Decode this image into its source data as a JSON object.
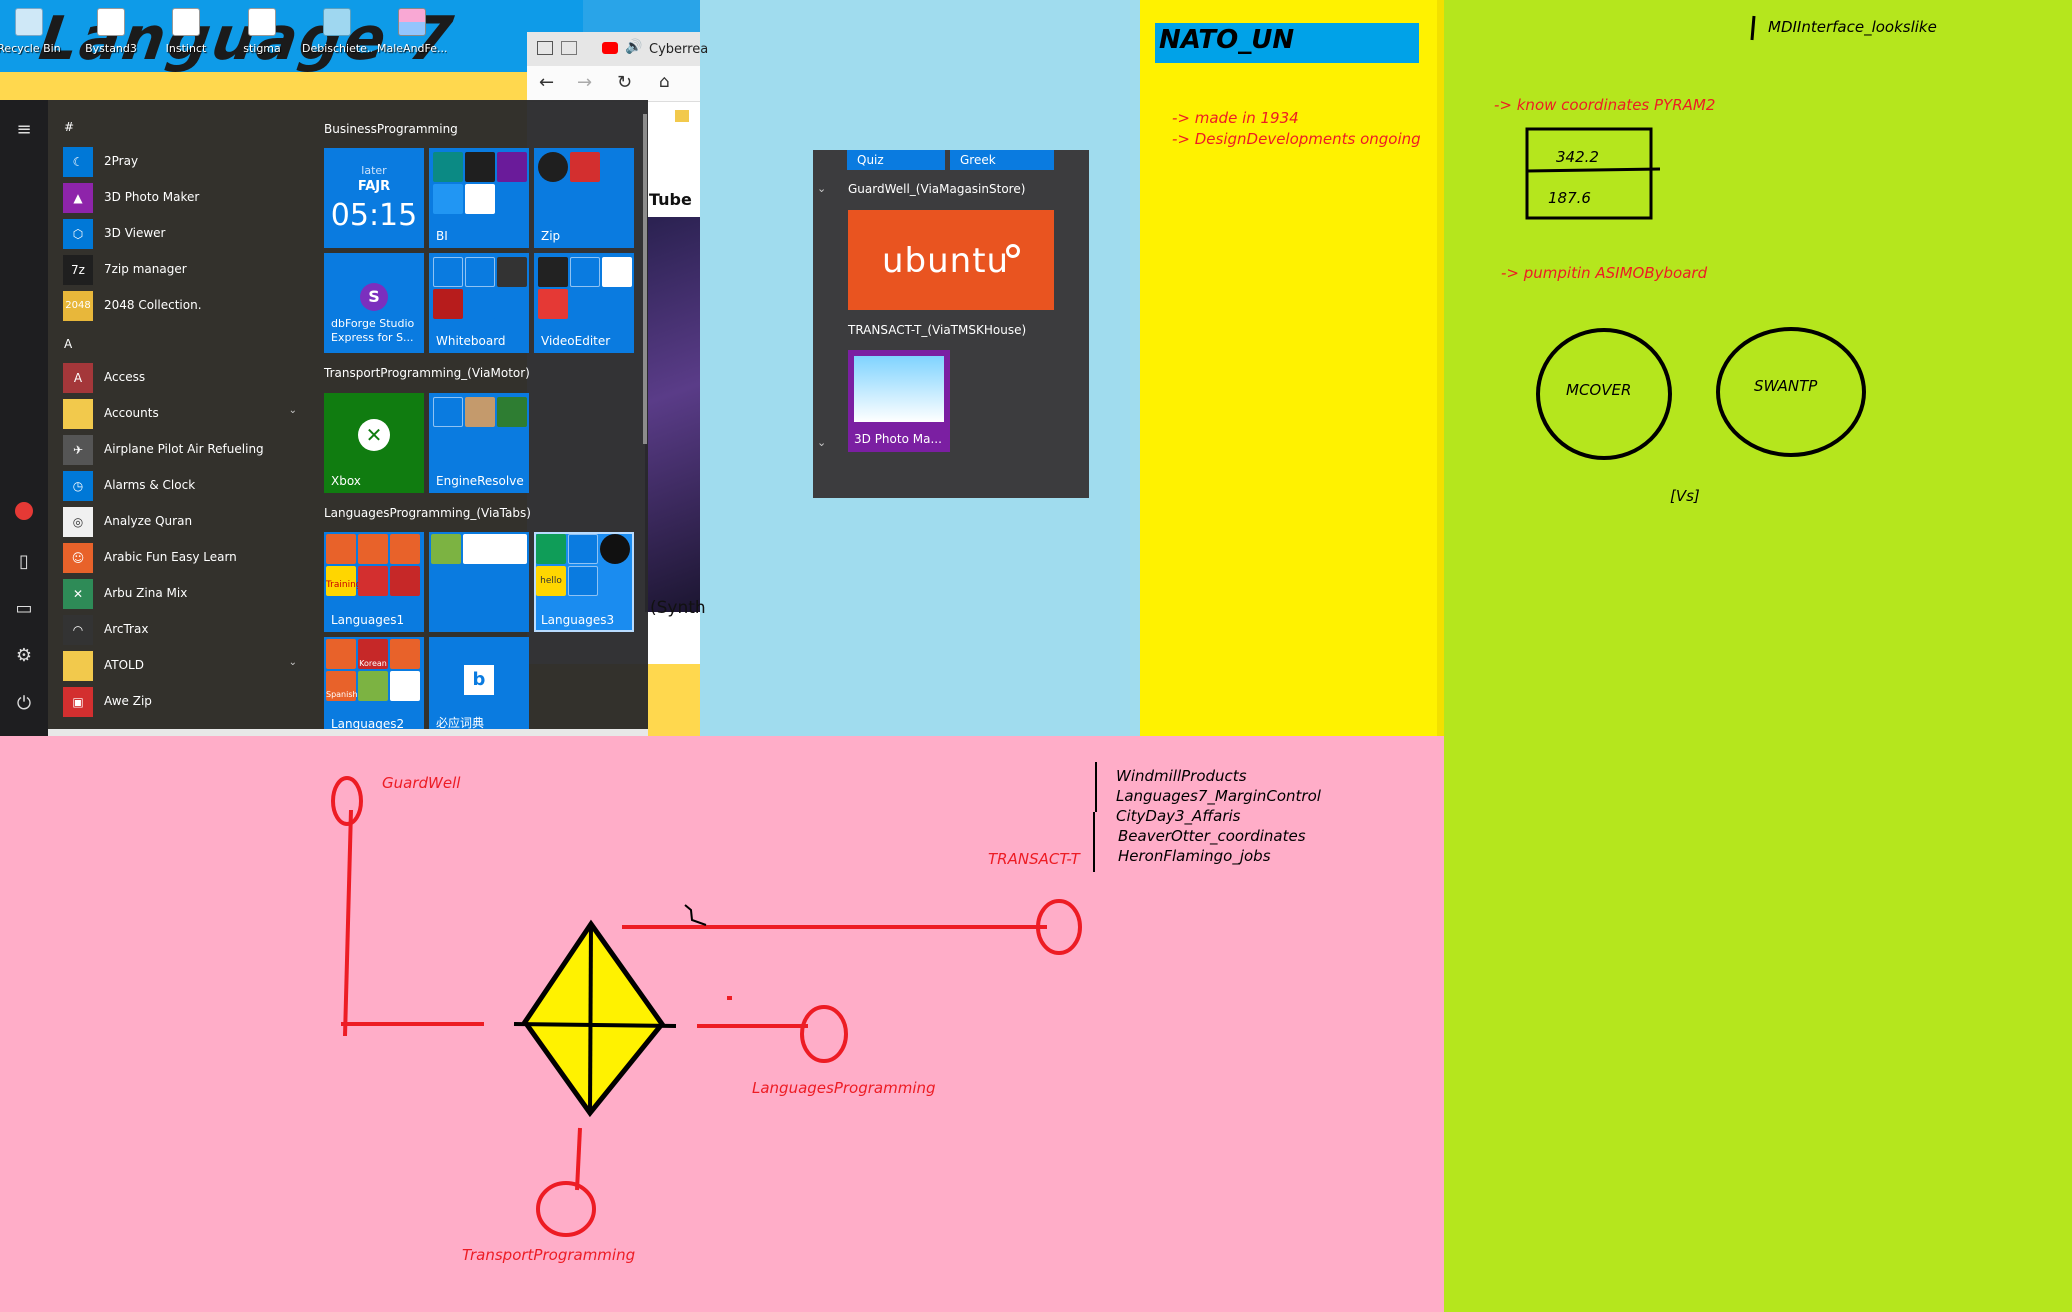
{
  "desktop": {
    "title_overlay": "Language 7",
    "icons": [
      {
        "name": "recycle-bin",
        "label": "Recycle Bin"
      },
      {
        "name": "bystand3",
        "label": "Bystand3"
      },
      {
        "name": "instinct",
        "label": "Instinct"
      },
      {
        "name": "stigma",
        "label": "stigma"
      },
      {
        "name": "debischiete",
        "label": "Debischiete..."
      },
      {
        "name": "maleandfe",
        "label": "MaleAndFe..."
      }
    ]
  },
  "browser": {
    "tab_label": "Cyberrea",
    "content_text": "Tube",
    "content_caption": "(Synth"
  },
  "start_menu": {
    "app_list": {
      "header_hash": "#",
      "header_a": "A",
      "apps": [
        {
          "label": "2Pray",
          "color": "#0078d7"
        },
        {
          "label": "3D Photo Maker",
          "color": "#8e24aa"
        },
        {
          "label": "3D Viewer",
          "color": "#0078d7"
        },
        {
          "label": "7zip manager",
          "color": "#1f1f1f"
        },
        {
          "label": "2048 Collection.",
          "color": "#e8b73a"
        },
        {
          "label": "Access",
          "color": "#a4373a"
        },
        {
          "label": "Accounts",
          "color": "#f2c94c"
        },
        {
          "label": "Airplane Pilot Air Refueling",
          "color": "#555555"
        },
        {
          "label": "Alarms & Clock",
          "color": "#0078d7"
        },
        {
          "label": "Analyze Quran",
          "color": "#f0f0f0"
        },
        {
          "label": "Arabic Fun Easy Learn",
          "color": "#e8622a"
        },
        {
          "label": "Arbu Zina Mix",
          "color": "#2e8b57"
        },
        {
          "label": "ArcTrax",
          "color": "#333333"
        },
        {
          "label": "ATOLD",
          "color": "#f2c94c"
        },
        {
          "label": "Awe Zip",
          "color": "#d32f2f"
        }
      ]
    },
    "groups": {
      "business": "BusinessProgramming",
      "transport": "TransportProgramming_(ViaMotor)",
      "languages": "LanguagesProgramming_(ViaTabs)"
    },
    "tiles": {
      "prayer_later": "later",
      "prayer_name": "FAJR",
      "prayer_time": "05:15",
      "bi": "BI",
      "zip": "Zip",
      "dbforge": "dbForge Studio Express for S...",
      "whiteboard": "Whiteboard",
      "videoediter": "VideoEditer",
      "xbox": "Xbox",
      "engineresolve": "EngineResolve",
      "languages1": "Languages1",
      "languages3": "Languages3",
      "languages2": "Languages2",
      "korean": "Korean",
      "spanish": "Spanish",
      "hello": "hello",
      "training": "Training",
      "bing_sub": "必应词典"
    }
  },
  "fragment": {
    "tab_quiz": "Quiz",
    "tab_greek": "Greek",
    "group_guardwell": "GuardWell_(ViaMagasinStore)",
    "ubuntu_label": "ubuntu",
    "group_transact": "TRANSACT-T_(ViaTMSKHouse)",
    "tile_3d": "3D Photo Ma..."
  },
  "nato": {
    "title": "NATO_UN",
    "note1": "-> made in 1934",
    "note2": "-> DesignDevelopments ongoing"
  },
  "green_panel": {
    "header": "MDIInterface_lookslike",
    "know_coords": "-> know coordinates PYRAM2",
    "value1": "342.2",
    "value2": "187.6",
    "pumpitin": "-> pumpitin ASIMOByboard",
    "circle1": "MCOVER",
    "circle2": "SWANTP",
    "vs": "[Vs]"
  },
  "pink_diagram": {
    "guardwell": "GuardWell",
    "transact": "TRANSACT-T",
    "languages": "LanguagesProgramming",
    "transport": "TransportProgramming",
    "list": [
      "WindmillProducts",
      "Languages7_MarginControl",
      "CityDay3_Affaris",
      "BeaverOtter_coordinates",
      "HeronFlamingo_jobs"
    ]
  },
  "colors": {
    "pink_bg": "#ffadc8",
    "green_bg": "#b5e61d",
    "yellow_bg": "#fff200",
    "light_blue_bg": "#a0dcee",
    "tile_blue": "#0a7be0",
    "red_ink": "#ed1c24",
    "ubuntu_orange": "#e95420",
    "nato_blue": "#00a2e8"
  }
}
